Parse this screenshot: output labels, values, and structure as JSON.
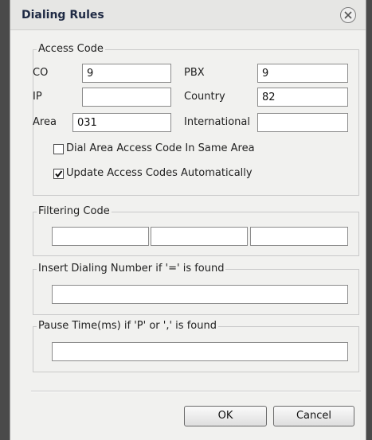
{
  "window": {
    "title": "Dialing Rules"
  },
  "access_code": {
    "legend": "Access Code",
    "co": {
      "label": "CO",
      "value": "9"
    },
    "pbx": {
      "label": "PBX",
      "value": "9"
    },
    "ip": {
      "label": "IP",
      "value": ""
    },
    "country": {
      "label": "Country",
      "value": "82"
    },
    "area": {
      "label": "Area",
      "value": "031"
    },
    "international": {
      "label": "International",
      "value": ""
    },
    "dial_area_same": {
      "label": "Dial Area Access Code In Same Area",
      "checked": false
    },
    "update_auto": {
      "label": "Update Access Codes Automatically",
      "checked": true
    }
  },
  "filtering_code": {
    "legend": "Filtering Code",
    "values": [
      "",
      "",
      ""
    ]
  },
  "insert_dialing": {
    "legend": "Insert Dialing Number if '=' is found",
    "value": ""
  },
  "pause_time": {
    "legend": "Pause Time(ms) if 'P' or ',' is found",
    "value": ""
  },
  "buttons": {
    "ok": "OK",
    "cancel": "Cancel"
  }
}
